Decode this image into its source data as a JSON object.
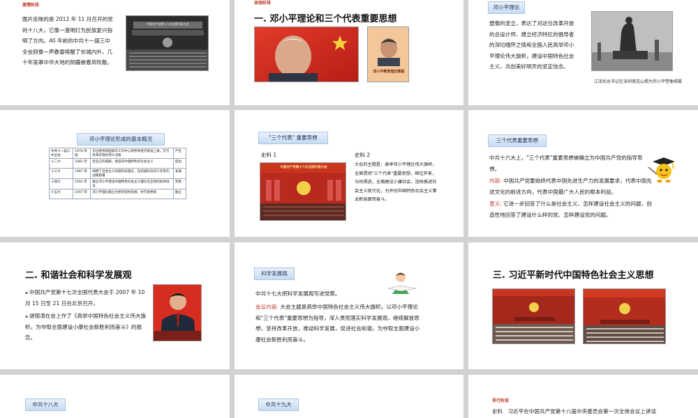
{
  "s1": {
    "tag": "激情阶段",
    "text": "图片反映的是 2012 年 11 月召开的党的十八大，它像一盏明灯为民族复兴指明了方向。40 年前的中共十一届三中全会则像一声春雷唤醒了长城内外，几十年笼罩中华大地的阴霾被春风吹散。",
    "photo_banner": "中国共产党第十八次全国代表大会"
  },
  "s2": {
    "tag": "体验阶段",
    "title": "一. 邓小平理论和三个代表重要思想",
    "book_title": "邓小平教育理论教程"
  },
  "s3": {
    "tab": "邓小平理论",
    "text": "塑像的竖立，表达了对这位改革开放的总设计师、建立经济特区的倡导者的深切缅怀之情和全国人民高举邓小平理论伟大旗帜，建设中国特色社会主义，共创美好明天的坚定信念。",
    "caption": "江泽民总书记在深圳莲花山揭为邓小平塑像揭幕"
  },
  "s4": {
    "tab": "邓小平理论形成的基本概况",
    "rows": [
      {
        "c1": "中共十一届三中全会",
        "c2": "1978 年底",
        "c3": "作出把党和国家的工作中心转移到经济建设上来，实行改革开放的伟大决策",
        "c4": "产生"
      },
      {
        "c1": "十二大",
        "c2": "1982 年",
        "c3": "走自己的道路，建设有中国特色的社会主义",
        "c4": "提出"
      },
      {
        "c1": "十三大",
        "c2": "1987 年",
        "c3": "阐明了社会主义初级阶段理论，在初级阶段的三步走的战略部署",
        "c4": "发展"
      },
      {
        "c1": "十四大",
        "c2": "1992 年",
        "c3": "确立邓小平建设中国特色社会主义理论在全党的指导地位",
        "c4": "完善"
      },
      {
        "c1": "十五大",
        "c2": "1997 年",
        "c3": "邓小平理论确立为党的指导思想，并写进党章",
        "c4": "确立"
      }
    ]
  },
  "s5": {
    "tab": "\"三个代表\" 重要思想",
    "src1": "史料 1",
    "src2": "史料 2",
    "banner": "中国共产党第十六次全国代表大会",
    "text": "大会的主题是：高举邓小平理论伟大旗帜，全面贯彻\"三个代表\"重要思想，继往开来，与时俱进，全面建设小康社会，加快推进社会主义现代化，为开创中国特色社会主义事业新局面而奋斗。"
  },
  "s6": {
    "tab": "三个代表重要思想",
    "intro": "中共十六大上，\"三个代表\"重要思想被确立为中国共产党的指导思想。",
    "content_label": "内容:",
    "content": "中国共产党要始终代表中国先进生产力的发展要求，代表中国先进文化的前进方向，代表中国最广大人民的根本利益。",
    "meaning_label": "意义:",
    "meaning": "它进一步回答了什么是社会主义、怎样建设社会主义的问题，创造性地回答了建设什么样的党、怎样建设党的问题。"
  },
  "s7": {
    "title": "二. 和谐社会和科学发展观",
    "b1": "中国共产党第十七次全国代表大会于 2007 年 10 月 15 日至 21 日在北京召开。",
    "b2": "胡锦涛在会上作了《高举中国特色社会主义伟大旗帜，为夺取全面建设小康社会新胜利而奋斗》的报告。"
  },
  "s8": {
    "tab": "科学发展观",
    "intro": "中共十七大把科学发展观写进党章。",
    "label": "会议内容:",
    "text": "大会主题是高举中国特色社会主义伟大旗帜，以邓小平理论和\"三个代表\"重要思想为指导，深入贯彻落实科学发展观，继续解放思想，坚持改革开放，推动科学发展，促进社会和谐，为夺取全面建设小康社会新胜利而奋斗。"
  },
  "s9": {
    "title": "三. 习近平新时代中国特色社会主义思想"
  },
  "s10": {
    "tab": "中共十八大"
  },
  "s11": {
    "tab": "中共十九大"
  },
  "s12": {
    "tag": "导行阶段",
    "label": "史料",
    "text": "习近平在中国共产党第十八届中央委员会第一次全体会议上讲话"
  }
}
